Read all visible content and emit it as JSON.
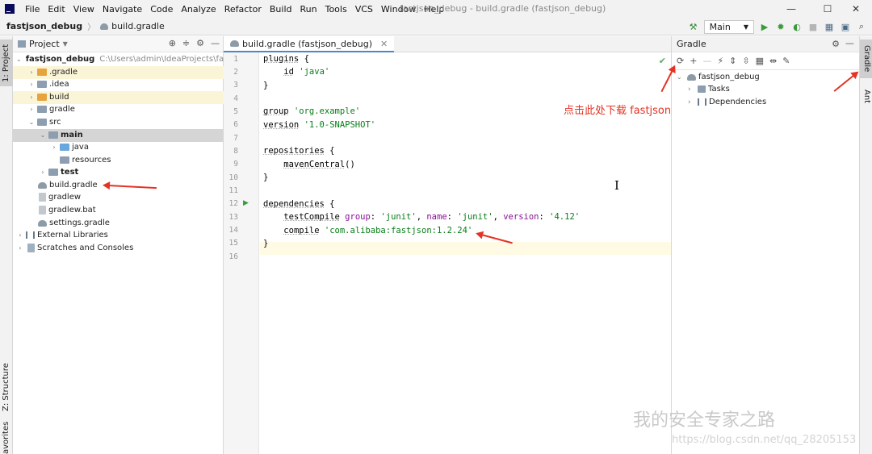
{
  "titlebar": {
    "menu": [
      "File",
      "Edit",
      "View",
      "Navigate",
      "Code",
      "Analyze",
      "Refactor",
      "Build",
      "Run",
      "Tools",
      "VCS",
      "Window",
      "Help"
    ],
    "window_title": "fastjson_debug - build.gradle (fastjson_debug)",
    "minimize": "—",
    "maximize": "☐",
    "close": "✕"
  },
  "navbar": {
    "project": "fastjson_debug",
    "file": "build.gradle",
    "run_config": "Main"
  },
  "left_strip": {
    "project_tab": "1: Project",
    "structure_tab": "Z: Structure",
    "favorites_tab": "avorites"
  },
  "project_panel": {
    "title": "Project",
    "tree": [
      {
        "label": "fastjson_debug",
        "extra": "C:\\Users\\admin\\IdeaProjects\\fastjs"
      },
      {
        "label": ".gradle"
      },
      {
        "label": ".idea"
      },
      {
        "label": "build"
      },
      {
        "label": "gradle"
      },
      {
        "label": "src"
      },
      {
        "label": "main"
      },
      {
        "label": "java"
      },
      {
        "label": "resources"
      },
      {
        "label": "test"
      },
      {
        "label": "build.gradle"
      },
      {
        "label": "gradlew"
      },
      {
        "label": "gradlew.bat"
      },
      {
        "label": "settings.gradle"
      },
      {
        "label": "External Libraries"
      },
      {
        "label": "Scratches and Consoles"
      }
    ]
  },
  "editor": {
    "tab": "build.gradle (fastjson_debug)",
    "line_numbers": [
      "1",
      "2",
      "3",
      "4",
      "5",
      "6",
      "7",
      "8",
      "9",
      "10",
      "11",
      "12",
      "13",
      "14",
      "15",
      "16"
    ],
    "lines": {
      "l1_kw": "plugins",
      "l1_rest": " {",
      "l2_kw": "id",
      "l2_str": "'java'",
      "l3": "}",
      "l5_kw": "group",
      "l5_str": "'org.example'",
      "l6_kw": "version",
      "l6_str": "'1.0-SNAPSHOT'",
      "l8_kw": "repositories",
      "l8_rest": " {",
      "l9_kw": "mavenCentral",
      "l9_rest": "()",
      "l10": "}",
      "l12_kw": "dependencies",
      "l12_rest": " {",
      "l13_kw": "testCompile",
      "l13_n1": "group",
      "l13_s1": "'junit'",
      "l13_n2": "name",
      "l13_s2": "'junit'",
      "l13_n3": "version",
      "l13_s3": "'4.12'",
      "l14_kw": "compile",
      "l14_str": "'com.alibaba:fastjson:1.2.24'",
      "l15": "}"
    }
  },
  "gradle_panel": {
    "title": "Gradle",
    "root": "fastjson_debug",
    "tasks": "Tasks",
    "dependencies": "Dependencies"
  },
  "right_strip": {
    "gradle_tab": "Gradle",
    "ant_tab": "Ant"
  },
  "annotation": {
    "text": "点击此处下载 fastjson",
    "color": "#e43324"
  },
  "watermark": {
    "text": "我的安全专家之路",
    "url": "https://blog.csdn.net/qq_28205153"
  }
}
